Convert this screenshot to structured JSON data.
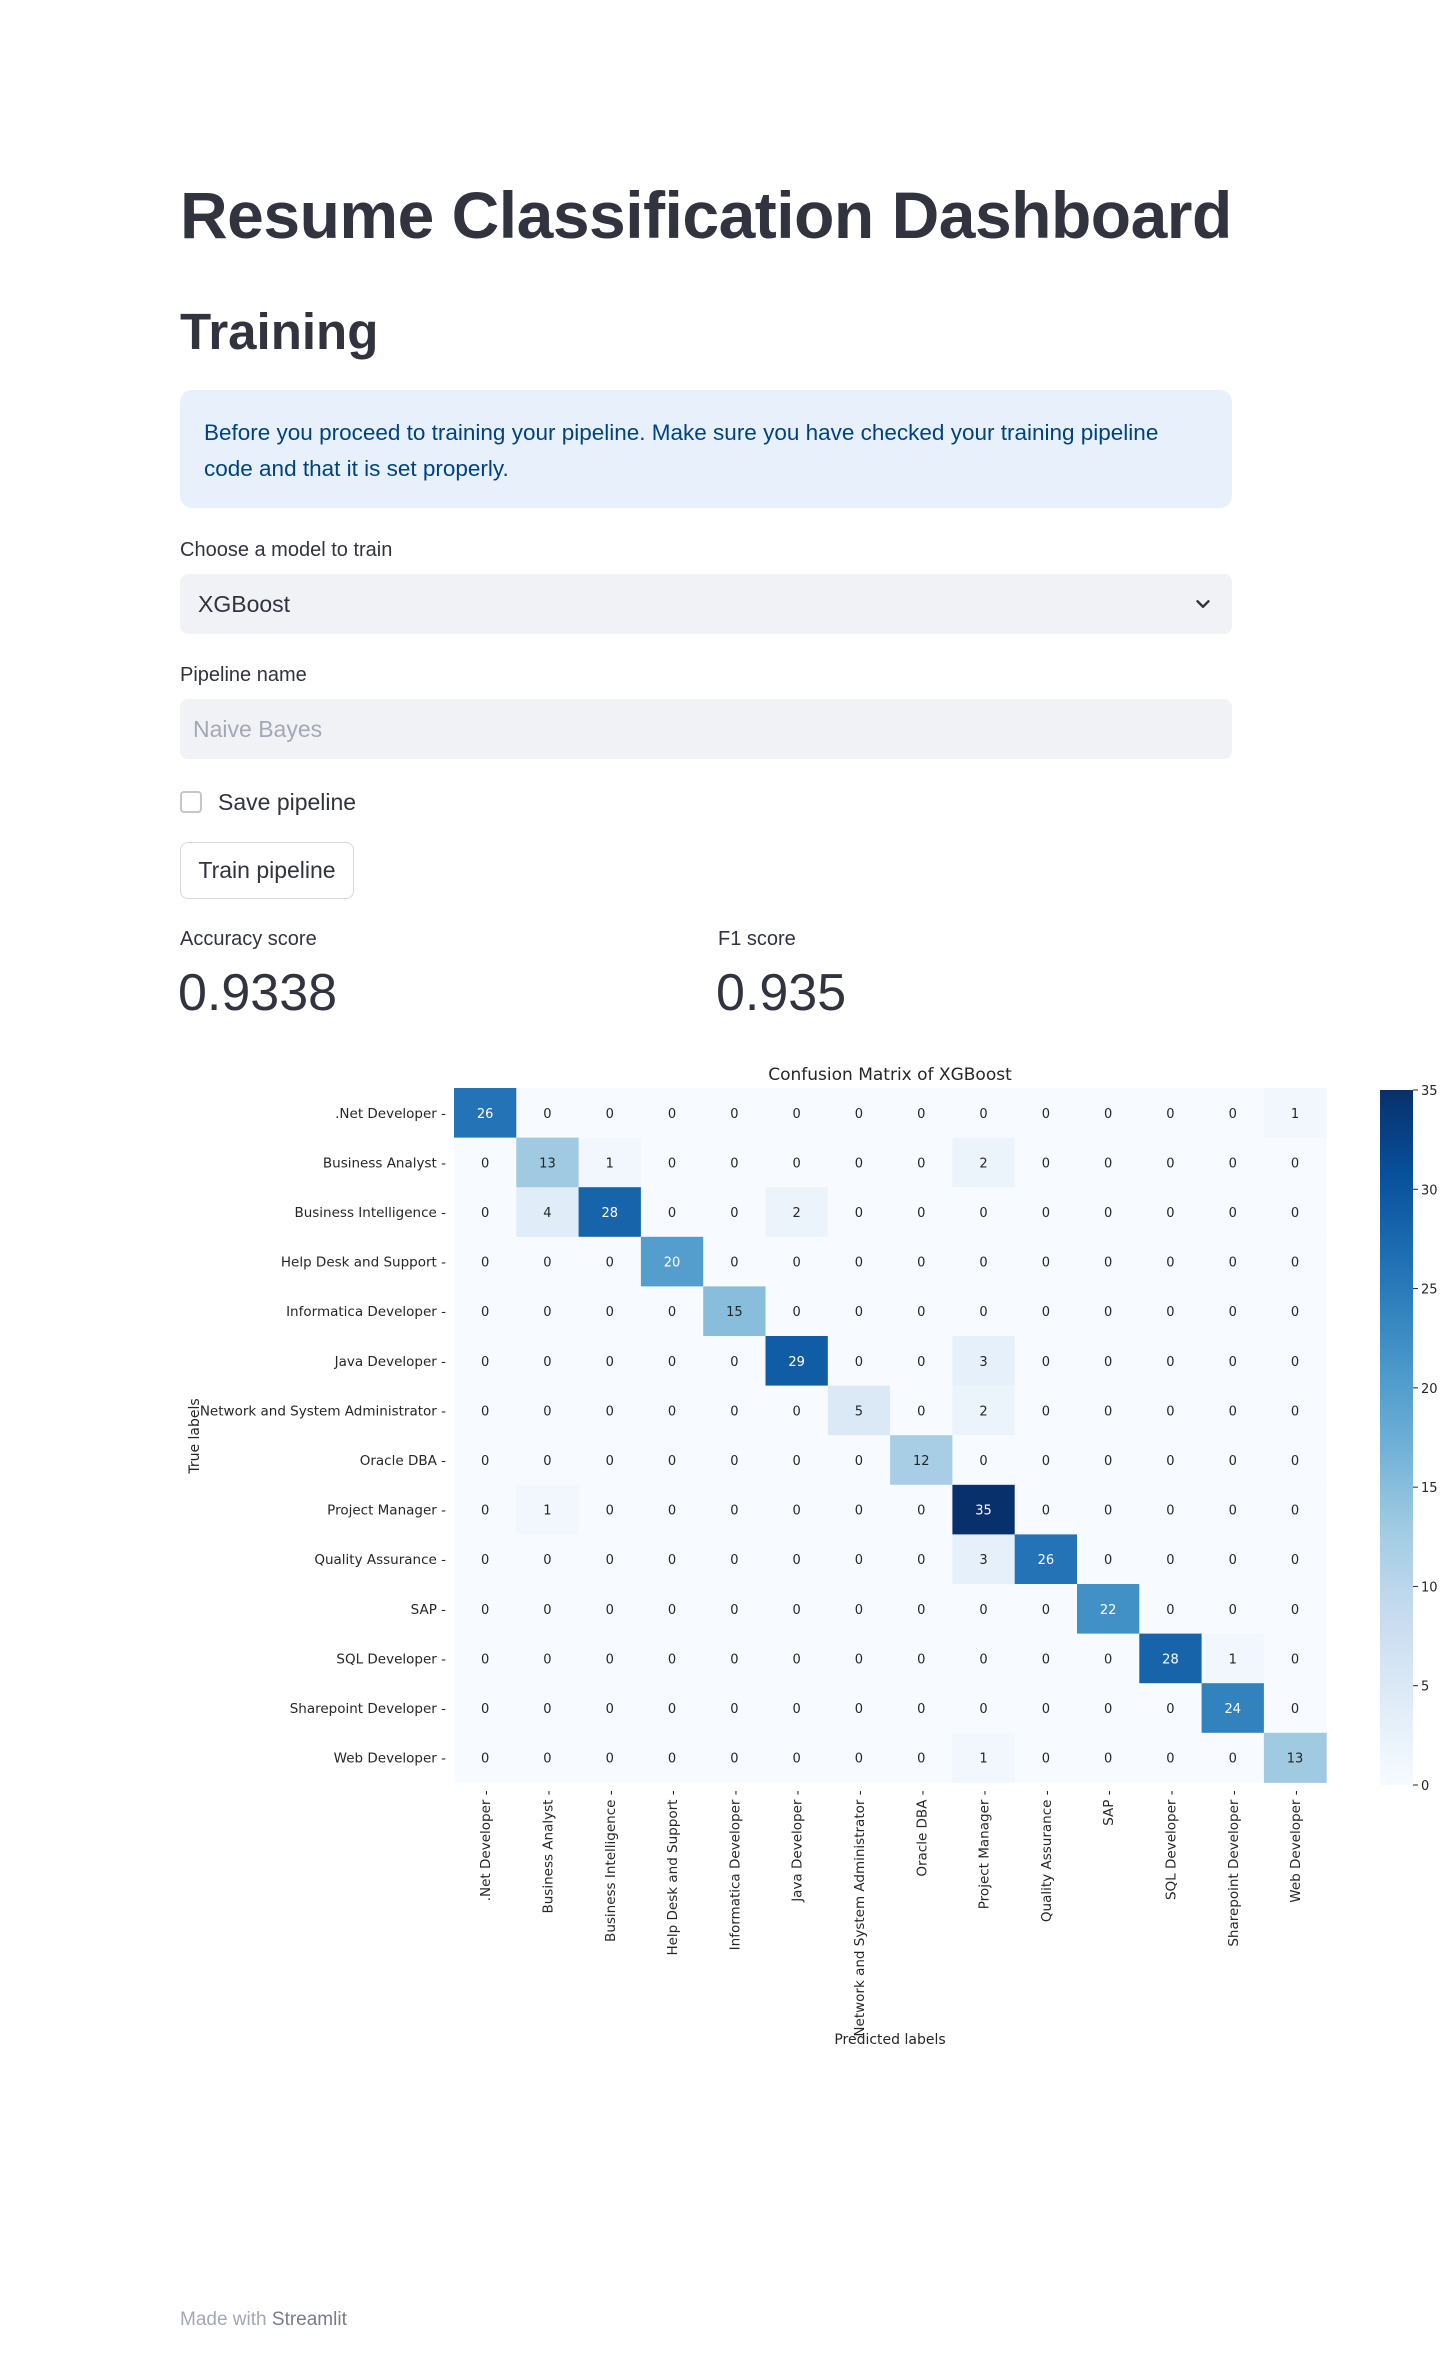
{
  "page": {
    "title": "Resume Classification Dashboard",
    "section": "Training"
  },
  "info_box": {
    "text": "Before you proceed to training your pipeline. Make sure you have checked your training pipeline code and that it is set properly."
  },
  "model_select": {
    "label": "Choose a model to train",
    "value": "XGBoost",
    "icon": "chevron-down-icon"
  },
  "pipeline_name": {
    "label": "Pipeline name",
    "placeholder": "Naive Bayes"
  },
  "save_checkbox": {
    "label": "Save pipeline",
    "checked": false
  },
  "train_button": {
    "label": "Train pipeline"
  },
  "metrics": {
    "accuracy": {
      "label": "Accuracy score",
      "value": "0.9338"
    },
    "f1": {
      "label": "F1 score",
      "value": "0.935"
    }
  },
  "chart_data": {
    "type": "heatmap",
    "title": "Confusion Matrix of XGBoost",
    "xlabel": "Predicted labels",
    "ylabel": "True labels",
    "labels": [
      ".Net Developer",
      "Business Analyst",
      "Business Intelligence",
      "Help Desk and Support",
      "Informatica Developer",
      "Java Developer",
      "Network and System Administrator",
      "Oracle DBA",
      "Project Manager",
      "Quality Assurance",
      "SAP",
      "SQL Developer",
      "Sharepoint Developer",
      "Web Developer"
    ],
    "matrix": [
      [
        26,
        0,
        0,
        0,
        0,
        0,
        0,
        0,
        0,
        0,
        0,
        0,
        0,
        1
      ],
      [
        0,
        13,
        1,
        0,
        0,
        0,
        0,
        0,
        2,
        0,
        0,
        0,
        0,
        0
      ],
      [
        0,
        4,
        28,
        0,
        0,
        2,
        0,
        0,
        0,
        0,
        0,
        0,
        0,
        0
      ],
      [
        0,
        0,
        0,
        20,
        0,
        0,
        0,
        0,
        0,
        0,
        0,
        0,
        0,
        0
      ],
      [
        0,
        0,
        0,
        0,
        15,
        0,
        0,
        0,
        0,
        0,
        0,
        0,
        0,
        0
      ],
      [
        0,
        0,
        0,
        0,
        0,
        29,
        0,
        0,
        3,
        0,
        0,
        0,
        0,
        0
      ],
      [
        0,
        0,
        0,
        0,
        0,
        0,
        5,
        0,
        2,
        0,
        0,
        0,
        0,
        0
      ],
      [
        0,
        0,
        0,
        0,
        0,
        0,
        0,
        12,
        0,
        0,
        0,
        0,
        0,
        0
      ],
      [
        0,
        1,
        0,
        0,
        0,
        0,
        0,
        0,
        35,
        0,
        0,
        0,
        0,
        0
      ],
      [
        0,
        0,
        0,
        0,
        0,
        0,
        0,
        0,
        3,
        26,
        0,
        0,
        0,
        0
      ],
      [
        0,
        0,
        0,
        0,
        0,
        0,
        0,
        0,
        0,
        0,
        22,
        0,
        0,
        0
      ],
      [
        0,
        0,
        0,
        0,
        0,
        0,
        0,
        0,
        0,
        0,
        0,
        28,
        1,
        0
      ],
      [
        0,
        0,
        0,
        0,
        0,
        0,
        0,
        0,
        0,
        0,
        0,
        0,
        24,
        0
      ],
      [
        0,
        0,
        0,
        0,
        0,
        0,
        0,
        0,
        1,
        0,
        0,
        0,
        0,
        13
      ]
    ],
    "colormap": "Blues",
    "colorbar_range": [
      0,
      35
    ],
    "colorbar_ticks": [
      0,
      5,
      10,
      15,
      20,
      25,
      30,
      35
    ]
  },
  "footer": {
    "prefix": "Made with",
    "brand": "Streamlit"
  }
}
